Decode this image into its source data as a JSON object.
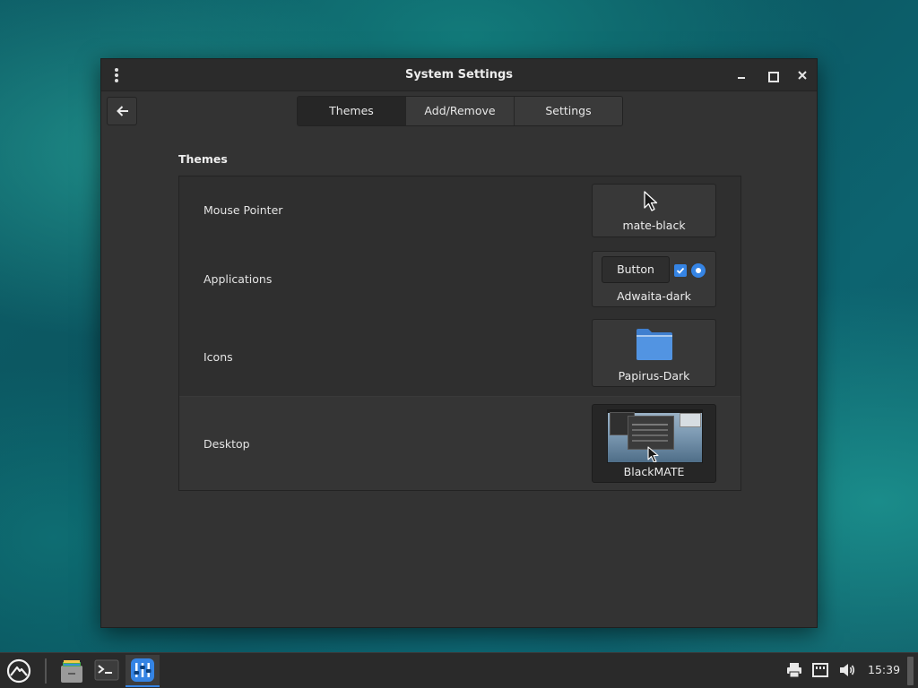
{
  "window": {
    "title": "System Settings"
  },
  "tabs": [
    {
      "label": "Themes",
      "active": true
    },
    {
      "label": "Add/Remove",
      "active": false
    },
    {
      "label": "Settings",
      "active": false
    }
  ],
  "section_title": "Themes",
  "rows": [
    {
      "label": "Mouse Pointer",
      "value": "mate-black",
      "preview_icon": "cursor-arrow-icon"
    },
    {
      "label": "Applications",
      "value": "Adwaita-dark",
      "sample_button": "Button",
      "preview_icon": "checkbox-radio-sample"
    },
    {
      "label": "Icons",
      "value": "Papirus-Dark",
      "preview_icon": "folder-icon"
    },
    {
      "label": "Desktop",
      "value": "BlackMATE",
      "preview_icon": "desktop-screenshot-thumbnail",
      "hovered": true
    }
  ],
  "taskbar": {
    "clock": "15:39",
    "apps": [
      "menu-logo-icon",
      "file-manager-icon",
      "terminal-icon",
      "settings-app-icon"
    ],
    "tray": [
      "printer-icon",
      "network-icon",
      "volume-icon"
    ]
  },
  "colors": {
    "accent": "#3584e4",
    "window_bg": "#333333",
    "titlebar_bg": "#2b2b2b",
    "taskbar_bg": "#2a2a2a",
    "folder_blue": "#4a90d9"
  }
}
